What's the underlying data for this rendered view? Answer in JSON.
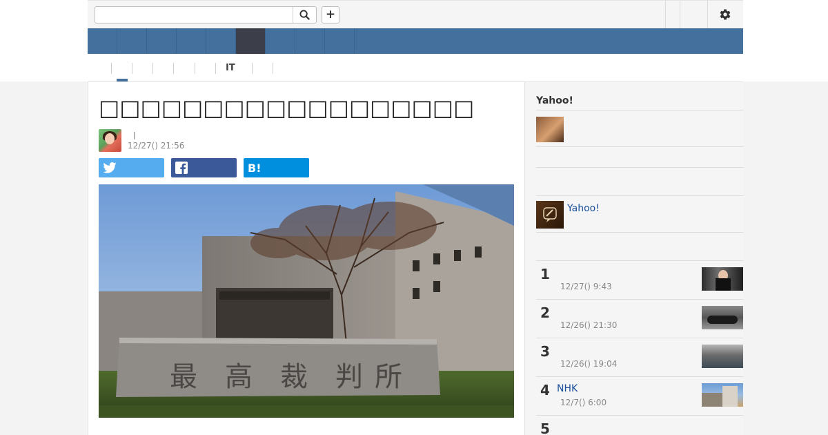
{
  "search": {
    "placeholder": ""
  },
  "header": {
    "add_label": "+"
  },
  "subnav": {
    "items": [
      "",
      "",
      "",
      "",
      "",
      "IT",
      "",
      ""
    ]
  },
  "article": {
    "headline": "□□□□□□□□□□□□□□□□□□",
    "author_sep": "|",
    "published": "12/27() 21:56",
    "hatena_label": "B!"
  },
  "sidebar": {
    "title": "Yahoo!",
    "yahoo_link": "Yahoo!",
    "ranking": [
      {
        "rank": "1",
        "title": "",
        "time": "12/27() 9:43"
      },
      {
        "rank": "2",
        "title": "",
        "time": "12/26() 21:30"
      },
      {
        "rank": "3",
        "title": "",
        "time": "12/26() 19:04"
      },
      {
        "rank": "4",
        "title": "NHK",
        "time": "12/7() 6:00"
      },
      {
        "rank": "5",
        "title": "",
        "time": ""
      }
    ]
  },
  "colors": {
    "nav": "#43709c",
    "nav_active": "#3c3f4a",
    "twitter": "#55acee",
    "facebook": "#3b5998",
    "hatena": "#008fde",
    "link": "#1a4f9a"
  },
  "icons": [
    "search-icon",
    "plus-icon",
    "gear-icon",
    "twitter-icon",
    "facebook-icon",
    "hatena-icon"
  ]
}
